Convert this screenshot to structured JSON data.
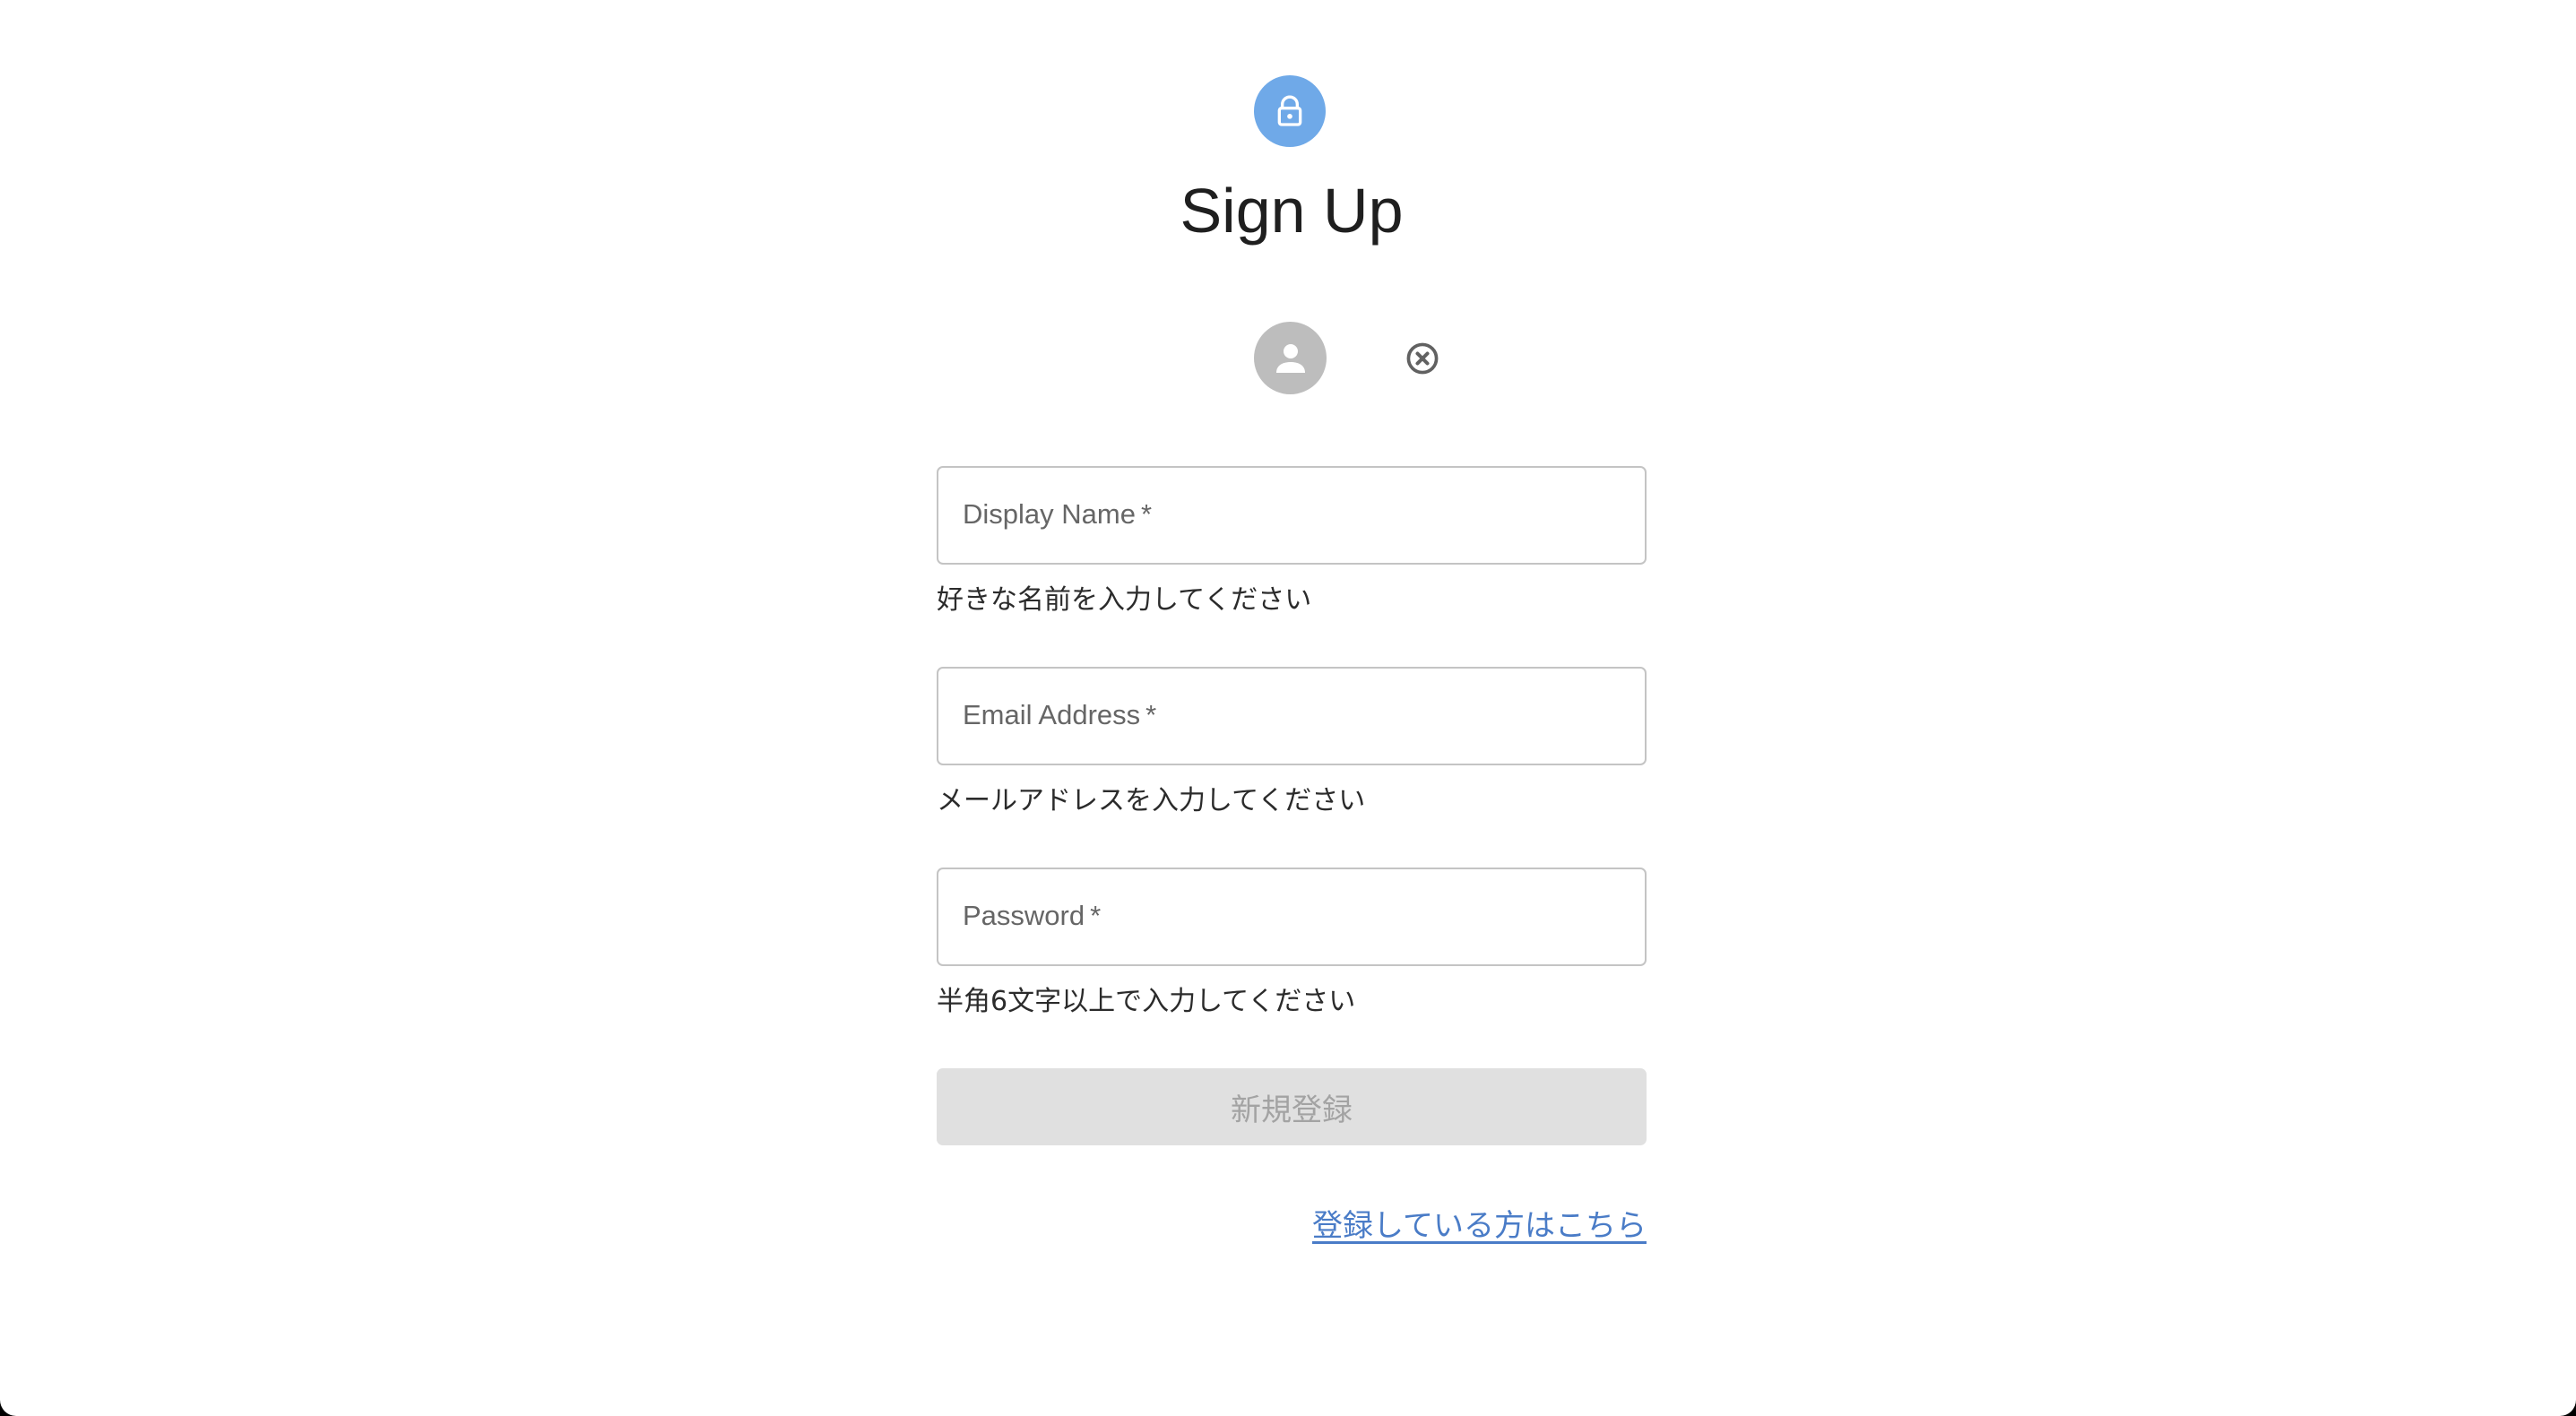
{
  "header": {
    "icon": "lock-icon",
    "title": "Sign Up",
    "icon_color": "#6fa9e8"
  },
  "avatar": {
    "icon": "person-icon",
    "remove_icon": "close-circle-icon"
  },
  "form": {
    "display_name": {
      "label": "Display Name",
      "required_mark": "*",
      "value": "",
      "helper": "好きな名前を入力してください"
    },
    "email": {
      "label": "Email Address",
      "required_mark": "*",
      "value": "",
      "helper": "メールアドレスを入力してください"
    },
    "password": {
      "label": "Password",
      "required_mark": "*",
      "value": "",
      "helper": "半角6文字以上で入力してください"
    },
    "submit_label": "新規登録",
    "submit_disabled": true
  },
  "footer": {
    "signin_link": "登録している方はこちら",
    "link_color": "#4a7cc7"
  }
}
